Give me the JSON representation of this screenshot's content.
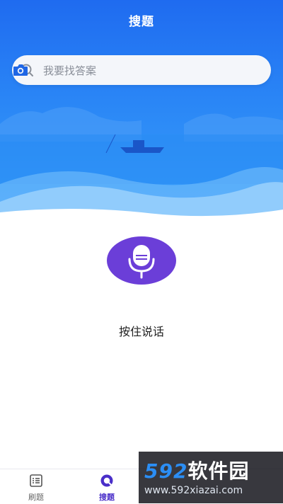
{
  "header": {
    "title": "搜题"
  },
  "search": {
    "placeholder": "我要找答案",
    "search_icon": "search-icon",
    "camera_icon": "camera-icon"
  },
  "voice": {
    "label": "按住说话",
    "icon": "microphone-icon",
    "accent": "#6b3ed8"
  },
  "tabbar": {
    "items": [
      {
        "label": "刷题",
        "icon": "list-icon",
        "active": false
      },
      {
        "label": "搜题",
        "icon": "search-tab-icon",
        "active": true
      }
    ],
    "active_color": "#4a2fc9"
  },
  "watermark": {
    "brand_num": "592",
    "brand_text": "软件园",
    "url": "www.592xiazai.com"
  },
  "colors": {
    "hero_top": "#1f6bf0",
    "hero_bottom": "#3aa3fb"
  }
}
